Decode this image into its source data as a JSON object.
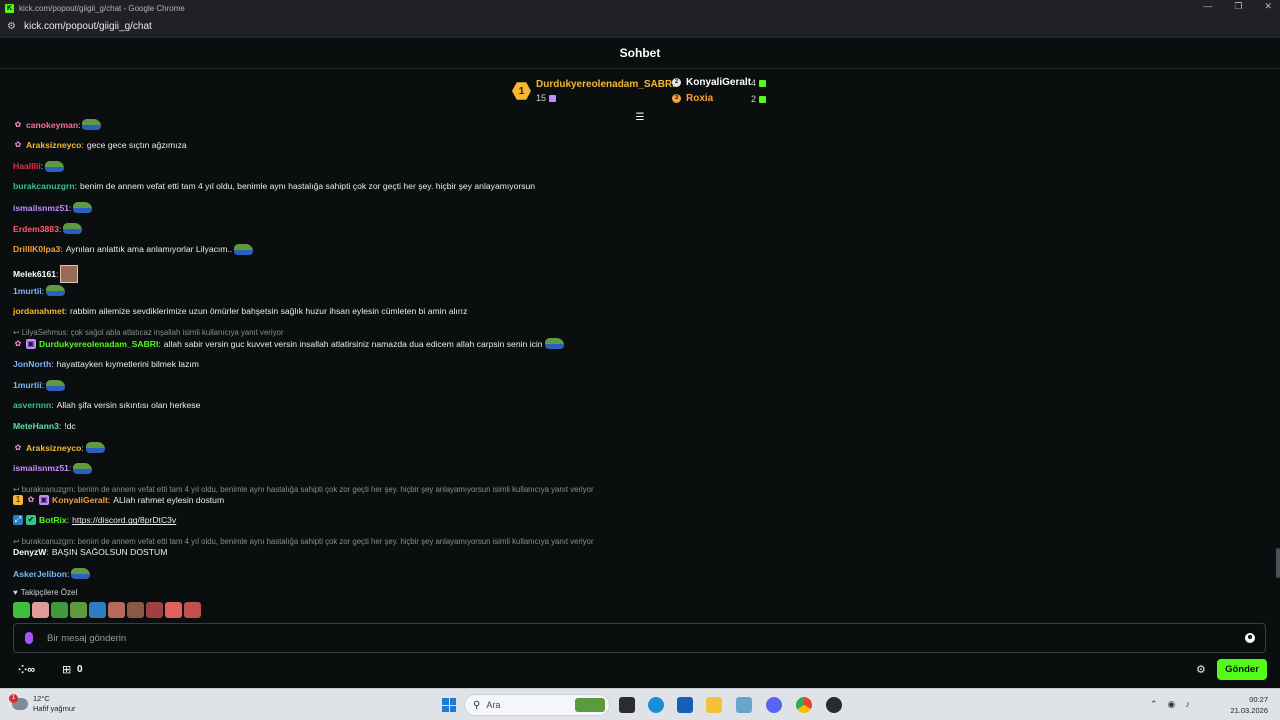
{
  "window": {
    "title": "kick.com/popout/giigii_g/chat - Google Chrome",
    "url": "kick.com/popout/giigii_g/chat",
    "minimize": "—",
    "restore": "❐",
    "close": "✕"
  },
  "chat": {
    "title": "Sohbet"
  },
  "leaderboard": {
    "first": {
      "rank": "1",
      "name": "Durdukyereolenadam_SABRI",
      "count": "15",
      "color": "#f5b82e"
    },
    "second": {
      "name": "KonyaliGeralt",
      "count": "4",
      "color": "#ffffff"
    },
    "third": {
      "name": "Roxia",
      "count": "2",
      "color": "#f5a23a"
    }
  },
  "messages": [
    {
      "user": "canokeyman",
      "color": "#ff6b9a",
      "text": "",
      "emote": "pepe",
      "badges": [
        "butterfly"
      ]
    },
    {
      "user": "Araksizneyco",
      "color": "#f5b82e",
      "text": "gece gece sıçtın ağzımıza",
      "emote": "",
      "badges": [
        "butterfly"
      ]
    },
    {
      "user": "Haalllii",
      "color": "#e5324d",
      "text": "",
      "emote": "pepe",
      "badges": []
    },
    {
      "user": "burakcanuzgrn",
      "color": "#31c48d",
      "text": "benim de annem vefat etti tam 4 yıl oldu, benimle aynı hastalığa sahipti çok zor geçti her şey. hiçbir şey anlayamıyorsun",
      "emote": "",
      "badges": []
    },
    {
      "user": "ismailsnmz51",
      "color": "#c58cff",
      "text": "",
      "emote": "pepe",
      "badges": []
    },
    {
      "user": "Erdem3883",
      "color": "#ff5d6c",
      "text": "",
      "emote": "pepe",
      "badges": []
    },
    {
      "user": "DrillIK0lpa3",
      "color": "#f59f3a",
      "text": "Aynıları anlattık ama anlamıyorlar Lilyacım..",
      "emote": "pepe",
      "badges": []
    },
    {
      "user": "Melek6161",
      "color": "#ffffff",
      "text": "",
      "emote": "photo",
      "badges": []
    },
    {
      "user": "1murtii",
      "color": "#7ab6ff",
      "text": "",
      "emote": "pepe",
      "badges": []
    },
    {
      "user": "jordanahmet",
      "color": "#f5b82e",
      "text": "rabbim ailemize sevdiklerimize uzun ömürler bahşetsin sağlık huzur ihsan eylesin cümleten bi amin alırız",
      "emote": "",
      "badges": []
    },
    {
      "user": "Durdukyereolenadam_SABRI",
      "color": "#53fc18",
      "text": "allah sabir versin guc kuvvet versin insallah atlatirsiniz namazda dua edicem allah carpsin senin icin",
      "emote": "pepe",
      "badges": [
        "butterfly",
        "gift"
      ],
      "reply": "LilyaSehmus: çok sağol abla atlatıcaz inşallah isimli kullanıcıya yanıt veriyor"
    },
    {
      "user": "JonNorth",
      "color": "#7ab6ff",
      "text": "hayattayken kıymetlerini bilmek lazım",
      "emote": "",
      "badges": []
    },
    {
      "user": "1murtii",
      "color": "#7ab6ff",
      "text": "",
      "emote": "pepe",
      "badges": []
    },
    {
      "user": "asvernnn",
      "color": "#31c48d",
      "text": "Allah şifa versin sıkıntısı olan herkese",
      "emote": "",
      "badges": []
    },
    {
      "user": "MeteHann3",
      "color": "#5ee0a0",
      "text": "!dc",
      "emote": "",
      "badges": []
    },
    {
      "user": "Araksizneyco",
      "color": "#f5b82e",
      "text": "",
      "emote": "pepe",
      "badges": [
        "butterfly"
      ]
    },
    {
      "user": "ismailsnmz51",
      "color": "#c58cff",
      "text": "",
      "emote": "pepe",
      "badges": []
    },
    {
      "user": "KonyaliGeralt",
      "color": "#f59f3a",
      "text": "ALlah rahmet eylesin dostum",
      "emote": "",
      "badges": [
        "coin",
        "butterfly",
        "gift"
      ],
      "reply": "burakcanuzgrn: benim de annem vefat etti tam 4 yıl oldu, benimle aynı hastalığa sahipti çok zor geçti her şey. hiçbir şey anlayamıyorsun isimli kullanıcıya yanıt veriyor"
    },
    {
      "user": "BotRix",
      "color": "#53fc18",
      "text": "",
      "link": "https://discord.gg/8prDtC3v",
      "emote": "",
      "badges": [
        "bot",
        "verified"
      ]
    },
    {
      "user": "DenyzW",
      "color": "#ffffff",
      "text": "BAŞIN SAĞOLSUN DOSTUM",
      "emote": "",
      "badges": [],
      "reply": "burakcanuzgrn: benim de annem vefat etti tam 4 yıl oldu, benimle aynı hastalığa sahipti çok zor geçti her şey. hiçbir şey anlayamıyorsun isimli kullanıcıya yanıt veriyor"
    },
    {
      "user": "AskerJelibon",
      "color": "#7ab6ff",
      "text": "",
      "emote": "pepe",
      "badges": []
    }
  ],
  "followers": {
    "label": "Takipçilere Özel",
    "emotes": [
      "#3fbf3f",
      "#e39a9a",
      "#3f9a3f",
      "#5f9a43",
      "#2b7fc0",
      "#b86a5a",
      "#8a5a48",
      "#a04040",
      "#e06060",
      "#c05050"
    ]
  },
  "input": {
    "placeholder": "Bir mesaj gönderin"
  },
  "bottombar": {
    "infinity": "∞",
    "gift_count": "0",
    "send_label": "Gönder"
  },
  "taskbar": {
    "temperature": "12°C",
    "weather": "Hafif yağmur",
    "weather_badge": "1",
    "search_placeholder": "Ara",
    "time": "00:27",
    "date": "21.03.2026"
  },
  "colors": {
    "accent": "#53fc18",
    "background": "#0b0e0f"
  }
}
